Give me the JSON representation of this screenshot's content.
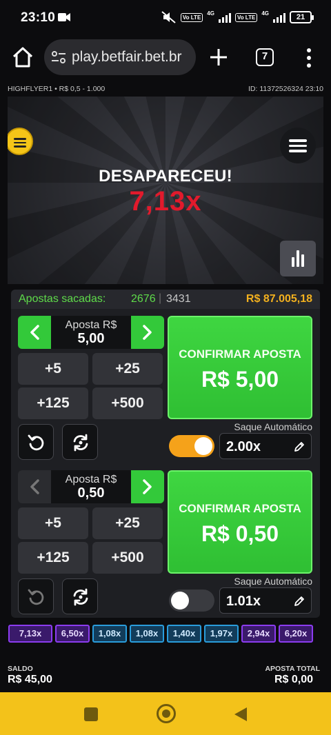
{
  "status_bar": {
    "time": "23:10",
    "lte1": "Vo LTE",
    "net1": "4G",
    "lte2": "Vo LTE",
    "net2": "4G",
    "battery": "21"
  },
  "browser": {
    "url": "play.betfair.bet.br",
    "tab_count": "7"
  },
  "game_header": {
    "left": "HIGHFLYER1 • R$ 0,5 - 1.000",
    "right": "ID: 11372526324 23:10"
  },
  "game": {
    "flew_title": "DESAPARECEU!",
    "multiplier": "7,13x",
    "colors": {
      "multiplier": "#e21a2c",
      "accent_yellow": "#f5c518"
    }
  },
  "panel": {
    "label": "Apostas sacadas:",
    "cashed_count": "2676",
    "separator": "|",
    "total_bets": "3431",
    "total_money": "R$ 87.005,18"
  },
  "bets": [
    {
      "stake_label": "Aposta R$",
      "stake_value": "5,00",
      "quick": [
        "+5",
        "+25",
        "+125",
        "+500"
      ],
      "confirm_label": "CONFIRMAR APOSTA",
      "confirm_amount": "R$ 5,00",
      "auto_label": "Saque Automático",
      "auto_enabled": true,
      "auto_value": "2.00x"
    },
    {
      "stake_label": "Aposta R$",
      "stake_value": "0,50",
      "quick": [
        "+5",
        "+25",
        "+125",
        "+500"
      ],
      "confirm_label": "CONFIRMAR APOSTA",
      "confirm_amount": "R$ 0,50",
      "auto_label": "Saque Automático",
      "auto_enabled": false,
      "auto_value": "1.01x"
    }
  ],
  "history": [
    {
      "value": "7,13x",
      "tone": "purple"
    },
    {
      "value": "6,50x",
      "tone": "purple"
    },
    {
      "value": "1,08x",
      "tone": "blue"
    },
    {
      "value": "1,08x",
      "tone": "blue"
    },
    {
      "value": "1,40x",
      "tone": "blue"
    },
    {
      "value": "1,97x",
      "tone": "blue"
    },
    {
      "value": "2,94x",
      "tone": "purple"
    },
    {
      "value": "6,20x",
      "tone": "purple"
    }
  ],
  "footer": {
    "balance_label": "SALDO",
    "balance_value": "R$ 45,00",
    "total_label": "APOSTA TOTAL",
    "total_value": "R$ 0,00"
  }
}
